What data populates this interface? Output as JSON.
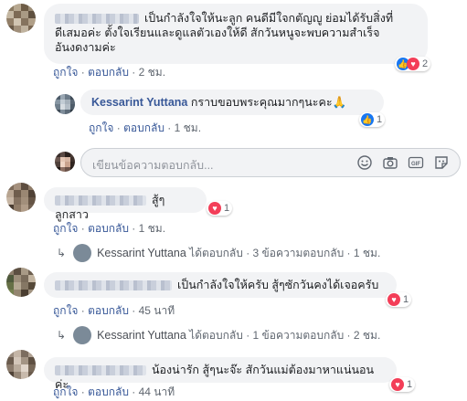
{
  "comments": [
    {
      "text_lines": [
        "เป็นกำลังใจให้นะลูก คนดีมีใจกตัญญู ย่อมได้รับสิ่งที่",
        "ดีเสมอค่ะ ตั้งใจเรียนและดูแลตัวเองให้ดี สักวันหนูจะพบความสำเร็จ",
        "อันงดงามค่ะ"
      ],
      "like": "ถูกใจ",
      "reply": "ตอบกลับ",
      "time": "2 ชม.",
      "reaction_count": "2"
    },
    {
      "text": "สู้ๆลูกสาว",
      "like": "ถูกใจ",
      "reply": "ตอบกลับ",
      "time": "1 ชม.",
      "reaction_count": "1"
    },
    {
      "text": "เป็นกำลังใจให้ครับ สู้ๆซักวันคงได้เจอครับ",
      "like": "ถูกใจ",
      "reply": "ตอบกลับ",
      "time": "45 นาที",
      "reaction_count": "1"
    },
    {
      "text": "น้องน่ารัก สู้ๆนะจ๊ะ สักวันแม่ต้องมาหาแน่นอนค่ะ",
      "like": "ถูกใจ",
      "reply": "ตอบกลับ",
      "time": "44 นาที",
      "reaction_count": "1"
    }
  ],
  "reply": {
    "author": "Kessarint Yuttana",
    "text": "กราบขอบพระคุณมากๆนะคะ",
    "emoji": "🙏",
    "like": "ถูกใจ",
    "reply": "ตอบกลับ",
    "time": "1 ชม.",
    "reaction_count": "1"
  },
  "reply_input": {
    "placeholder": "เขียนข้อความตอบกลับ..."
  },
  "reply_summaries": [
    {
      "author": "Kessarint Yuttana",
      "action": "ได้ตอบกลับ",
      "count": "3 ข้อความตอบกลับ",
      "time": "1 ชม."
    },
    {
      "author": "Kessarint Yuttana",
      "action": "ได้ตอบกลับ",
      "count": "1 ข้อความตอบกลับ",
      "time": "2 ชม."
    }
  ],
  "icons": [
    "like-icon",
    "love-icon",
    "emoji-icon",
    "camera-icon",
    "gif-icon",
    "sticker-icon",
    "reply-arrow-icon"
  ]
}
